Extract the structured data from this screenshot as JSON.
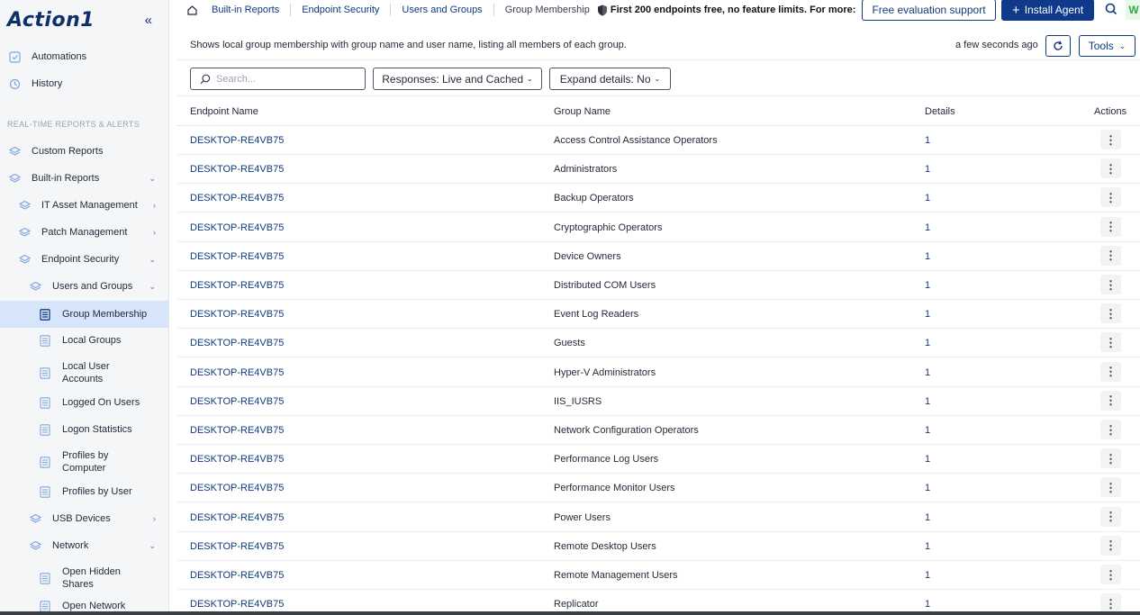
{
  "app": {
    "logo": "Action1"
  },
  "sidebar": {
    "section_title": "REAL-TIME REPORTS & ALERTS",
    "items": [
      {
        "label": "Automations",
        "icon": "automations-icon"
      },
      {
        "label": "History",
        "icon": "history-icon"
      },
      {
        "label": "Custom Reports",
        "icon": "layers-icon"
      },
      {
        "label": "Built-in Reports",
        "icon": "layers-icon"
      },
      {
        "label": "IT Asset Management",
        "icon": "layers-icon"
      },
      {
        "label": "Patch Management",
        "icon": "layers-icon"
      },
      {
        "label": "Endpoint Security",
        "icon": "layers-icon"
      },
      {
        "label": "Users and Groups",
        "icon": "layers-icon"
      },
      {
        "label": "Group Membership",
        "icon": "document-icon"
      },
      {
        "label": "Local Groups",
        "icon": "document-icon"
      },
      {
        "label": "Local User Accounts",
        "line1": "Local User",
        "line2": "Accounts",
        "icon": "document-icon"
      },
      {
        "label": "Logged On Users",
        "icon": "document-icon"
      },
      {
        "label": "Logon Statistics",
        "icon": "document-icon"
      },
      {
        "label": "Profiles by Computer",
        "line1": "Profiles by",
        "line2": "Computer",
        "icon": "document-icon"
      },
      {
        "label": "Profiles by User",
        "icon": "document-icon"
      },
      {
        "label": "USB Devices",
        "icon": "layers-icon"
      },
      {
        "label": "Network",
        "icon": "layers-icon"
      },
      {
        "label": "Open Hidden Shares",
        "line1": "Open Hidden",
        "line2": "Shares",
        "icon": "document-icon"
      },
      {
        "label": "Open Network",
        "line1": "Open Network",
        "icon": "document-icon"
      }
    ]
  },
  "breadcrumb": [
    "Built-in Reports",
    "Endpoint Security",
    "Users and Groups",
    "Group Membership"
  ],
  "promo": {
    "bold": "First 200 endpoints free, no feature limits. For more:"
  },
  "top_buttons": {
    "evaluation": "Free evaluation support",
    "install": "Install Agent",
    "avatar": "W"
  },
  "report": {
    "description": "Shows local group membership with group name and user name, listing all members of each group.",
    "updated": "a few seconds ago",
    "tools_label": "Tools",
    "search_placeholder": "Search...",
    "responses_filter": "Responses: Live and Cached",
    "expand_filter": "Expand details: No"
  },
  "table": {
    "columns": [
      "Endpoint Name",
      "Group Name",
      "Details",
      "Actions"
    ],
    "rows": [
      {
        "endpoint": "DESKTOP-RE4VB75",
        "group": "Access Control Assistance Operators",
        "details": "1"
      },
      {
        "endpoint": "DESKTOP-RE4VB75",
        "group": "Administrators",
        "details": "1"
      },
      {
        "endpoint": "DESKTOP-RE4VB75",
        "group": "Backup Operators",
        "details": "1"
      },
      {
        "endpoint": "DESKTOP-RE4VB75",
        "group": "Cryptographic Operators",
        "details": "1"
      },
      {
        "endpoint": "DESKTOP-RE4VB75",
        "group": "Device Owners",
        "details": "1"
      },
      {
        "endpoint": "DESKTOP-RE4VB75",
        "group": "Distributed COM Users",
        "details": "1"
      },
      {
        "endpoint": "DESKTOP-RE4VB75",
        "group": "Event Log Readers",
        "details": "1"
      },
      {
        "endpoint": "DESKTOP-RE4VB75",
        "group": "Guests",
        "details": "1"
      },
      {
        "endpoint": "DESKTOP-RE4VB75",
        "group": "Hyper-V Administrators",
        "details": "1"
      },
      {
        "endpoint": "DESKTOP-RE4VB75",
        "group": "IIS_IUSRS",
        "details": "1"
      },
      {
        "endpoint": "DESKTOP-RE4VB75",
        "group": "Network Configuration Operators",
        "details": "1"
      },
      {
        "endpoint": "DESKTOP-RE4VB75",
        "group": "Performance Log Users",
        "details": "1"
      },
      {
        "endpoint": "DESKTOP-RE4VB75",
        "group": "Performance Monitor Users",
        "details": "1"
      },
      {
        "endpoint": "DESKTOP-RE4VB75",
        "group": "Power Users",
        "details": "1"
      },
      {
        "endpoint": "DESKTOP-RE4VB75",
        "group": "Remote Desktop Users",
        "details": "1"
      },
      {
        "endpoint": "DESKTOP-RE4VB75",
        "group": "Remote Management Users",
        "details": "1"
      },
      {
        "endpoint": "DESKTOP-RE4VB75",
        "group": "Replicator",
        "details": "1"
      }
    ]
  },
  "colors": {
    "brand": "#0f3a7d",
    "active_bg": "#d7e5fb",
    "sidebar_bg": "#f5f6f8"
  }
}
